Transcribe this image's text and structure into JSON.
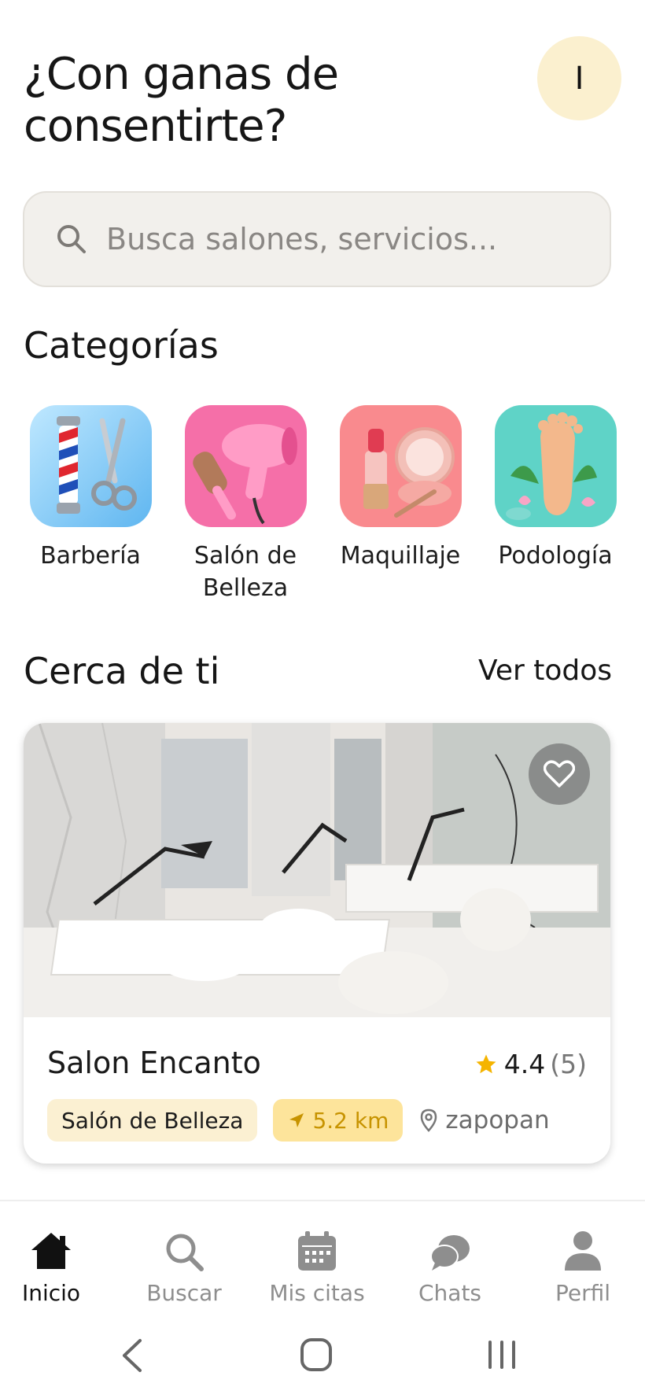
{
  "header": {
    "greeting": "¿Con ganas de consentirte?",
    "avatar_initial": "I"
  },
  "search": {
    "icon": "search-icon",
    "placeholder": "Busca salones, servicios..."
  },
  "categories": {
    "title": "Categorías",
    "items": [
      {
        "label": "Barbería",
        "icon": "barber-pole-icon"
      },
      {
        "label": "Salón de Belleza",
        "icon": "hair-dryer-icon"
      },
      {
        "label": "Maquillaje",
        "icon": "makeup-icon"
      },
      {
        "label": "Podología",
        "icon": "foot-icon"
      }
    ]
  },
  "nearby": {
    "title": "Cerca de ti",
    "see_all": "Ver todos",
    "salon": {
      "name": "Salon Encanto",
      "rating": "4.4",
      "review_count": "(5)",
      "category": "Salón de Belleza",
      "distance": "5.2 km",
      "location": "zapopan"
    }
  },
  "bottom_nav": {
    "items": [
      {
        "label": "Inicio",
        "icon": "home-icon",
        "active": true
      },
      {
        "label": "Buscar",
        "icon": "search-icon",
        "active": false
      },
      {
        "label": "Mis citas",
        "icon": "calendar-icon",
        "active": false
      },
      {
        "label": "Chats",
        "icon": "chat-icon",
        "active": false
      },
      {
        "label": "Perfil",
        "icon": "user-icon",
        "active": false
      }
    ]
  },
  "colors": {
    "accent": "#f5b400",
    "avatar_bg": "#fbf0cf",
    "tag_category_bg": "#fbf0d2",
    "tag_distance_bg": "#fde49b"
  }
}
